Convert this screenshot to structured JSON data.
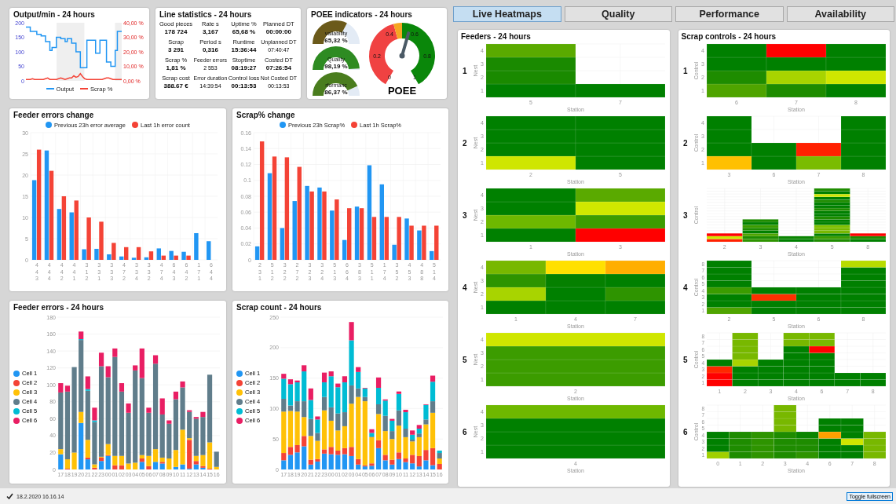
{
  "output_chart": {
    "title": "Output/min - 24 hours",
    "chart_data": {
      "type": "line",
      "ylim": [
        0,
        200
      ],
      "yticks": [
        0,
        50,
        100,
        150,
        200
      ],
      "y2lim": [
        0,
        40
      ],
      "y2ticks": [
        {
          "value": 0,
          "label": "0,00 %"
        },
        {
          "value": 10,
          "label": "10,00 %"
        },
        {
          "value": 20,
          "label": "20,00 %"
        },
        {
          "value": 30,
          "label": "30,00 %"
        },
        {
          "value": 40,
          "label": "40,00 %"
        }
      ],
      "series": [
        {
          "name": "Output",
          "color": "#2196f3",
          "values": [
            185,
            185,
            170,
            170,
            170,
            160,
            160,
            155,
            155,
            135,
            135,
            105,
            115,
            115,
            150,
            150,
            145,
            145,
            135,
            145,
            145,
            130,
            130,
            100,
            100,
            45,
            45,
            45,
            140,
            140,
            140,
            140,
            95,
            95,
            140,
            140,
            140,
            65,
            65,
            50,
            50,
            105,
            170,
            170,
            170
          ]
        },
        {
          "name": "Scrap %",
          "color": "#f44336",
          "axis": "y2",
          "values": [
            1,
            1,
            1,
            1.5,
            1,
            1,
            1,
            1,
            1,
            1.5,
            2,
            1,
            1,
            1,
            1,
            1.5,
            2,
            1.5,
            1,
            1.5,
            2,
            2,
            3.5,
            2.5,
            3,
            5,
            3,
            1.5,
            1,
            1,
            1,
            1,
            1,
            1,
            1,
            1,
            1.5,
            2,
            2,
            1.5,
            1,
            1,
            1,
            1,
            1
          ]
        }
      ]
    }
  },
  "line_statistics": {
    "title": "Line statistics - 24 hours",
    "items": [
      {
        "label": "Good pieces",
        "value": "178 724",
        "kind": "major"
      },
      {
        "label": "Rate s",
        "value": "3,167",
        "kind": "major"
      },
      {
        "label": "Uptime %",
        "value": "65,68 %",
        "kind": "major"
      },
      {
        "label": "Planned DT",
        "value": "00:00:00",
        "kind": "major"
      },
      {
        "label": "Scrap",
        "value": "3 291",
        "kind": "major"
      },
      {
        "label": "Period s",
        "value": "0,316",
        "kind": "major"
      },
      {
        "label": "Runtime",
        "value": "15:36:44",
        "kind": "major"
      },
      {
        "label": "Unplanned DT",
        "value": "07:40:47",
        "kind": "minor"
      },
      {
        "label": "Scrap %",
        "value": "1,81 %",
        "kind": "major"
      },
      {
        "label": "Feeder errors",
        "value": "2 553",
        "kind": "minor"
      },
      {
        "label": "Stoptime",
        "value": "08:19:27",
        "kind": "major"
      },
      {
        "label": "Costed DT",
        "value": "07:26:54",
        "kind": "major"
      },
      {
        "label": "Scrap cost",
        "value": "388.67 €",
        "kind": "major"
      },
      {
        "label": "Error duration",
        "value": "14:39:54",
        "kind": "minor"
      },
      {
        "label": "Control loss",
        "value": "00:13:53",
        "kind": "major"
      },
      {
        "label": "Not Costed DT",
        "value": "00:13:53",
        "kind": "minor"
      }
    ]
  },
  "poee": {
    "title": "POEE indicators - 24 hours",
    "gauges": [
      {
        "label": "vailability",
        "value": "65,32 %",
        "color": "#6b5a1a"
      },
      {
        "label": "Quality",
        "value": "98,19 %",
        "color": "#2e8b22"
      },
      {
        "label": "rformanc",
        "value": "86,37 %",
        "color": "#4a7d1e"
      }
    ],
    "dial": {
      "title": "POEE",
      "ticks": [
        "0",
        "0.2",
        "0.4",
        "0.6",
        "0.8",
        "1"
      ]
    }
  },
  "feeder_errors_change": {
    "title": "Feeder errors change",
    "chart_data": {
      "type": "bar",
      "grid": true,
      "categories": [
        "4\n4\n3",
        "4\n4\n4",
        "4\n4\n2",
        "4\n4\n1",
        "3\n1\n2",
        "3\n3\n1",
        "3\n3\n3",
        "4\n7\n2",
        "3\n3\n4",
        "3\n3\n2",
        "4\n7\n4",
        "6\n4\n3",
        "6\n4\n2",
        "1\n7\n1",
        "6\n4\n4"
      ],
      "ylim": [
        0,
        30
      ],
      "yticks": [
        0,
        5,
        10,
        15,
        20,
        25,
        30
      ],
      "series": [
        {
          "name": "Previous 23h error average",
          "color": "#2196f3",
          "values": [
            18.8,
            25.8,
            12,
            11.2,
            2.5,
            2.6,
            1.3,
            0.8,
            0.5,
            0.6,
            2.7,
            2.1,
            1.9,
            6.3,
            4.4
          ]
        },
        {
          "name": "Last 1h error count",
          "color": "#f44336",
          "values": [
            26,
            21,
            15,
            14,
            10,
            9,
            4,
            3,
            3,
            2,
            1,
            1,
            1,
            0,
            0
          ]
        }
      ]
    }
  },
  "scrap_change": {
    "title": "Scrap% change",
    "chart_data": {
      "type": "bar",
      "grid": true,
      "categories": [
        "2\n3\n1",
        "5\n1\n2",
        "3\n2\n2",
        "2\n7\n2",
        "3\n2\n3",
        "3\n2\n4",
        "5\n1\n3",
        "6\n6\n4",
        "3\n8\n3",
        "5\n1\n1",
        "1\n7\n4",
        "3\n5\n2",
        "4\n5\n3",
        "4\n8\n8",
        "5\n1\n4"
      ],
      "ylim": [
        0,
        0.16
      ],
      "yticks": [
        0,
        0.02,
        0.04,
        0.06,
        0.08,
        0.1,
        0.12,
        0.14,
        0.16
      ],
      "series": [
        {
          "name": "Previous 23h Scrap%",
          "color": "#2196f3",
          "values": [
            0.017,
            0.109,
            0.04,
            0.074,
            0.093,
            0.091,
            0.062,
            0.025,
            0.067,
            0.119,
            0.095,
            0.019,
            0.052,
            0.037,
            0.011
          ]
        },
        {
          "name": "Last 1h Scrap%",
          "color": "#f44336",
          "values": [
            0.149,
            0.13,
            0.129,
            0.117,
            0.086,
            0.086,
            0.076,
            0.065,
            0.065,
            0.054,
            0.054,
            0.054,
            0.043,
            0.043,
            0.043
          ]
        }
      ]
    }
  },
  "feeder_errors": {
    "title": "Feeder errors - 24 hours",
    "chart_data": {
      "type": "bar",
      "stacked": true,
      "grid": true,
      "categories": [
        "17",
        "18",
        "19",
        "20",
        "21",
        "22",
        "23",
        "00",
        "01",
        "02",
        "03",
        "04",
        "05",
        "06",
        "07",
        "08",
        "09",
        "10",
        "11",
        "12",
        "13",
        "14",
        "15",
        "16"
      ],
      "ylim": [
        0,
        180
      ],
      "yticks": [
        0,
        20,
        40,
        60,
        80,
        100,
        120,
        140,
        160,
        180
      ],
      "series": [
        {
          "name": "Cell 1",
          "color": "#2196f3",
          "values": [
            18,
            0,
            0,
            55,
            12,
            0,
            10,
            16,
            0,
            0,
            0,
            0,
            9,
            0,
            9,
            7,
            0,
            3,
            6,
            1,
            6,
            2,
            0,
            0
          ]
        },
        {
          "name": "Cell 2",
          "color": "#f44336",
          "values": [
            0,
            1,
            0,
            0,
            2,
            2,
            4,
            1,
            5,
            5,
            0,
            0,
            4,
            4,
            0,
            2,
            0,
            0,
            0,
            34,
            4,
            2,
            1,
            0
          ]
        },
        {
          "name": "Cell 3",
          "color": "#ffc107",
          "values": [
            6,
            11,
            20,
            13,
            21,
            4,
            1,
            13,
            11,
            11,
            7,
            8,
            4,
            12,
            15,
            5,
            13,
            20,
            41,
            2,
            6,
            13,
            31,
            3
          ]
        },
        {
          "name": "Cell 4",
          "color": "#607d8b",
          "values": [
            67,
            80,
            101,
            85,
            58,
            50,
            107,
            79,
            117,
            76,
            60,
            109,
            91,
            51,
            101,
            51,
            41,
            60,
            50,
            31,
            44,
            45,
            80,
            18
          ]
        },
        {
          "name": "Cell 5",
          "color": "#00bcd4",
          "values": [
            0,
            0,
            0,
            1,
            2,
            2,
            0,
            0,
            0,
            0,
            0,
            0,
            0,
            0,
            0,
            0,
            0,
            0,
            0,
            0,
            0,
            0,
            0,
            0
          ]
        },
        {
          "name": "Cell 6",
          "color": "#e91e63",
          "values": [
            11,
            7,
            0,
            9,
            15,
            15,
            16,
            13,
            10,
            10,
            11,
            6,
            35,
            6,
            10,
            19,
            4,
            9,
            7,
            2,
            2,
            6,
            0,
            0
          ]
        }
      ]
    }
  },
  "scrap_count": {
    "title": "Scrap count - 24 hours",
    "chart_data": {
      "type": "bar",
      "stacked": true,
      "grid": true,
      "categories": [
        "17",
        "18",
        "19",
        "20",
        "21",
        "22",
        "23",
        "00",
        "01",
        "02",
        "03",
        "04",
        "05",
        "06",
        "07",
        "08",
        "09",
        "10",
        "11",
        "12",
        "13",
        "14",
        "15",
        "16"
      ],
      "ylim": [
        0,
        250
      ],
      "yticks": [
        0,
        50,
        100,
        150,
        200,
        250
      ],
      "series": [
        {
          "name": "Cell 1",
          "color": "#2196f3",
          "values": [
            15,
            24,
            28,
            38,
            8,
            13,
            26,
            25,
            24,
            25,
            22,
            8,
            5,
            6,
            35,
            15,
            8,
            17,
            12,
            10,
            5,
            15,
            7,
            0
          ]
        },
        {
          "name": "Cell 2",
          "color": "#f44336",
          "values": [
            12,
            13,
            12,
            17,
            8,
            4,
            7,
            12,
            7,
            10,
            15,
            9,
            2,
            4,
            13,
            9,
            8,
            11,
            6,
            14,
            17,
            17,
            28,
            9
          ]
        },
        {
          "name": "Cell 3",
          "color": "#ffc107",
          "values": [
            68,
            59,
            55,
            31,
            39,
            30,
            64,
            43,
            33,
            36,
            71,
            102,
            105,
            43,
            43,
            39,
            34,
            44,
            35,
            22,
            31,
            42,
            58,
            9
          ]
        },
        {
          "name": "Cell 4",
          "color": "#607d8b",
          "values": [
            21,
            9,
            17,
            26,
            28,
            13,
            22,
            22,
            28,
            23,
            30,
            14,
            7,
            1,
            16,
            25,
            13,
            25,
            14,
            3,
            6,
            8,
            19,
            9
          ]
        },
        {
          "name": "Cell 5",
          "color": "#00bcd4",
          "values": [
            33,
            35,
            31,
            49,
            31,
            22,
            24,
            51,
            43,
            49,
            74,
            27,
            14,
            6,
            27,
            25,
            17,
            27,
            27,
            8,
            8,
            24,
            32,
            4
          ]
        },
        {
          "name": "Cell 6",
          "color": "#e91e63",
          "values": [
            8,
            8,
            3,
            10,
            19,
            5,
            16,
            8,
            6,
            10,
            30,
            8,
            1,
            6,
            17,
            2,
            3,
            4,
            4,
            7,
            6,
            1,
            10,
            0
          ]
        }
      ]
    }
  },
  "tabs": [
    {
      "label": "Live Heatmaps",
      "selected": true
    },
    {
      "label": "Quality",
      "selected": false
    },
    {
      "label": "Performance",
      "selected": false
    },
    {
      "label": "Availability",
      "selected": false
    }
  ],
  "feeders_heatmaps": {
    "title": "Feeders - 24 hours",
    "blocks": [
      {
        "label": "1",
        "y_title": "Nest",
        "x_title": "Station",
        "y_ticks": [
          "4",
          "3",
          "2",
          "1"
        ],
        "columns": [
          {
            "label": "5",
            "cells": [
              {
                "color": "#008000"
              },
              {
                "color": "#1a8a00"
              },
              {
                "color": "#1a8a00"
              },
              {
                "color": "#5aaa00"
              }
            ]
          },
          {
            "label": "7",
            "cells": [
              {
                "color": "#008000"
              }
            ]
          }
        ]
      },
      {
        "label": "2",
        "y_title": "Nest",
        "x_title": "Station",
        "y_ticks": [
          "4",
          "3",
          "2",
          "1"
        ],
        "columns": [
          {
            "label": "2",
            "cells": [
              {
                "color": "#cfe600"
              },
              {
                "color": "#008000"
              },
              {
                "color": "#008000"
              },
              {
                "color": "#008000"
              }
            ]
          },
          {
            "label": "5",
            "cells": [
              {
                "color": "#008000"
              },
              {
                "color": "#008000"
              },
              {
                "color": "#008000"
              },
              {
                "color": "#008000"
              }
            ]
          }
        ]
      },
      {
        "label": "3",
        "y_title": "Nest",
        "x_title": "Station",
        "y_ticks": [
          "4",
          "3",
          "2",
          "1"
        ],
        "columns": [
          {
            "label": "1",
            "cells": [
              {
                "color": "#008000"
              },
              {
                "color": "#6eb800"
              },
              {
                "color": "#008000"
              },
              {
                "color": "#008000"
              }
            ]
          },
          {
            "label": "3",
            "cells": [
              {
                "color": "#ff0000"
              },
              {
                "color": "#3c9c00"
              },
              {
                "color": "#d0e800"
              },
              {
                "color": "#5aaa00"
              }
            ]
          }
        ]
      },
      {
        "label": "4",
        "y_title": "Nest",
        "x_title": "Station",
        "y_ticks": [
          "4",
          "3",
          "2",
          "1"
        ],
        "columns": [
          {
            "label": "1",
            "cells": [
              {
                "color": "#008000"
              },
              {
                "color": "#a8d400"
              },
              {
                "color": "#2e9400"
              },
              {
                "color": "#78b800"
              }
            ]
          },
          {
            "label": "4",
            "cells": [
              {
                "color": "#008000"
              },
              {
                "color": "#008000"
              },
              {
                "color": "#058000"
              },
              {
                "color": "#ffe000"
              }
            ]
          },
          {
            "label": "7",
            "cells": [
              {
                "color": "#008000"
              },
              {
                "color": "#2e9400"
              },
              {
                "color": "#008000"
              },
              {
                "color": "#ffae00"
              }
            ]
          }
        ]
      },
      {
        "label": "5",
        "y_title": "Nest",
        "x_title": "Station",
        "y_ticks": [
          "4",
          "3",
          "2",
          "1"
        ],
        "columns": [
          {
            "label": "2",
            "cells": [
              {
                "color": "#3c9c00"
              },
              {
                "color": "#3c9c00"
              },
              {
                "color": "#3c9c00"
              },
              {
                "color": "#cfe600"
              }
            ]
          }
        ]
      },
      {
        "label": "6",
        "y_title": "Nest",
        "x_title": "Station",
        "y_ticks": [
          "4",
          "3",
          "2",
          "1"
        ],
        "columns": [
          {
            "label": "4",
            "cells": [
              {
                "color": "#008000"
              },
              {
                "color": "#008000"
              },
              {
                "color": "#008000"
              },
              {
                "color": "#6eb800"
              }
            ]
          }
        ]
      }
    ]
  },
  "scrap_controls_heatmaps": {
    "title": "Scrap controls - 24 hours",
    "blocks": [
      {
        "label": "1",
        "y_title": "Control",
        "x_title": "Station",
        "y_ticks": [
          "4",
          "3",
          "2",
          "1"
        ],
        "columns": [
          {
            "label": "6",
            "cells": [
              {
                "color": "#4fa400"
              },
              {
                "color": "#1e8c00"
              },
              {
                "color": "#008000"
              },
              {
                "color": "#008000"
              }
            ]
          },
          {
            "label": "7",
            "cells": [
              {
                "color": "#1e8c00"
              },
              {
                "color": "#a8d400"
              },
              {
                "color": "#008000"
              },
              {
                "color": "#ff0000"
              }
            ]
          },
          {
            "label": "8",
            "cells": [
              {
                "color": "#008000"
              },
              {
                "color": "#cfe600"
              },
              {
                "color": "#008000"
              },
              {
                "color": "#008000"
              }
            ]
          }
        ]
      },
      {
        "label": "2",
        "y_title": "Control",
        "x_title": "Station",
        "y_ticks": [
          "4",
          "3",
          "2",
          "1"
        ],
        "columns": [
          {
            "label": "3",
            "cells": [
              {
                "color": "#ffc000"
              },
              {
                "color": "#008000"
              },
              {
                "color": "#008000"
              },
              {
                "color": "#008000"
              }
            ]
          },
          {
            "label": "6",
            "cells": [
              {
                "color": "#008000"
              },
              {
                "color": "#008000"
              }
            ]
          },
          {
            "label": "7",
            "cells": [
              {
                "color": "#7abc00"
              },
              {
                "color": "#ff2000"
              }
            ]
          },
          {
            "label": "8",
            "cells": [
              {
                "color": "#008000"
              },
              {
                "color": "#008000"
              },
              {
                "color": "#008000"
              },
              {
                "color": "#008000"
              }
            ]
          }
        ]
      },
      {
        "label": "3",
        "y_title": "Control",
        "x_title": "Station",
        "columns": [
          {
            "label": "2",
            "cells": [
              {
                "color": "#ff2000"
              },
              {
                "color": "#cfe600"
              },
              {
                "color": "#ff0000"
              }
            ]
          },
          {
            "label": "3",
            "cells": [
              {
                "color": "#2e9400"
              },
              {
                "color": "#1e8c00"
              },
              {
                "color": "#4fa400"
              },
              {
                "color": "#008000"
              },
              {
                "color": "#1e8c00"
              },
              {
                "color": "#3c9c00"
              },
              {
                "color": "#008000"
              },
              {
                "color": "#1e8c00"
              }
            ]
          },
          {
            "label": "4",
            "cells": [
              {
                "color": "#008000"
              },
              {
                "color": "#0a8400"
              }
            ]
          },
          {
            "label": "5",
            "cells": [
              {
                "color": "#1e8c00"
              },
              {
                "color": "#3c9c00"
              },
              {
                "color": "#008000"
              },
              {
                "color": "#78b800"
              },
              {
                "color": "#78b800"
              },
              {
                "color": "#80c000"
              },
              {
                "color": "#008000"
              },
              {
                "color": "#008000"
              },
              {
                "color": "#1e8c00"
              },
              {
                "color": "#008000"
              },
              {
                "color": "#008000"
              },
              {
                "color": "#1e8c00"
              },
              {
                "color": "#008000"
              },
              {
                "color": "#008000"
              },
              {
                "color": "#1e8c00"
              },
              {
                "color": "#008000"
              },
              {
                "color": "#cfe600"
              },
              {
                "color": "#008000"
              },
              {
                "color": "#1e8c00"
              }
            ]
          },
          {
            "label": "8",
            "cells": [
              {
                "color": "#008000"
              },
              {
                "color": "#1e8c00"
              },
              {
                "color": "#ff0000"
              }
            ]
          }
        ]
      },
      {
        "label": "4",
        "y_title": "Control",
        "x_title": "Station",
        "y_ticks": [
          "8",
          "7",
          "6",
          "5",
          "4",
          "3",
          "2",
          "1"
        ],
        "columns": [
          {
            "label": "2",
            "cells": [
              {
                "color": "#4fa400"
              },
              {
                "color": "#008000"
              },
              {
                "color": "#008000"
              },
              {
                "color": "#3c9c00"
              },
              {
                "color": "#008000"
              },
              {
                "color": "#008000"
              },
              {
                "color": "#008000"
              },
              {
                "color": "#008000"
              }
            ]
          },
          {
            "label": "5",
            "cells": [
              {
                "color": "#008000"
              },
              {
                "color": "#008000"
              },
              {
                "color": "#ff3000"
              },
              {
                "color": "#008000"
              }
            ]
          },
          {
            "label": "6",
            "cells": [
              {
                "color": "#008000"
              },
              {
                "color": "#008000"
              },
              {
                "color": "#008000"
              },
              {
                "color": "#008000"
              }
            ]
          },
          {
            "label": "8",
            "cells": [
              {
                "color": "#008000"
              },
              {
                "color": "#008000"
              },
              {
                "color": "#008000"
              },
              {
                "color": "#008000"
              },
              {
                "color": "#008000"
              },
              {
                "color": "#008000"
              },
              {
                "color": "#008000"
              },
              {
                "color": "#b8dc00"
              }
            ]
          }
        ]
      },
      {
        "label": "5",
        "y_title": "Control",
        "x_title": "Station",
        "y_ticks": [
          "8",
          "7",
          "6",
          "5",
          "4",
          "3",
          "2",
          "1"
        ],
        "columns": [
          {
            "label": "1",
            "cells": [
              {
                "color": "#ff0000"
              },
              {
                "color": "#ff0000"
              },
              {
                "color": "#ff2800"
              },
              {
                "color": "#008000"
              }
            ]
          },
          {
            "label": "2",
            "cells": [
              {
                "color": "#008000"
              },
              {
                "color": "#008000"
              },
              {
                "color": "#008000"
              },
              {
                "color": "#a8d400"
              },
              {
                "color": "#78b800"
              },
              {
                "color": "#78b800"
              },
              {
                "color": "#78b800"
              },
              {
                "color": "#78b800"
              }
            ]
          },
          {
            "label": "3",
            "cells": [
              {
                "color": "#008000"
              },
              {
                "color": "#008000"
              },
              {
                "color": "#008000"
              },
              {
                "color": "#008000"
              }
            ]
          },
          {
            "label": "4",
            "cells": [
              {
                "color": "#008000"
              },
              {
                "color": "#008000"
              },
              {
                "color": "#008000"
              },
              {
                "color": "#008000"
              },
              {
                "color": "#008000"
              },
              {
                "color": "#008000"
              },
              {
                "color": "#78b800"
              },
              {
                "color": "#78b800"
              }
            ]
          },
          {
            "label": "6",
            "cells": [
              {
                "color": "#008000"
              },
              {
                "color": "#008000"
              },
              {
                "color": "#008000"
              },
              {
                "color": "#008000"
              },
              {
                "color": "#008000"
              },
              {
                "color": "#ff0000"
              },
              {
                "color": "#78b800"
              },
              {
                "color": "#78b800"
              }
            ]
          },
          {
            "label": "7",
            "cells": [
              {
                "color": "#008000"
              },
              {
                "color": "#008000"
              }
            ]
          },
          {
            "label": "8",
            "cells": [
              {
                "color": "#008000"
              },
              {
                "color": "#008000"
              }
            ]
          }
        ]
      },
      {
        "label": "6",
        "y_title": "Control",
        "x_title": "Station",
        "y_ticks": [
          "8",
          "7",
          "6",
          "5",
          "4",
          "3",
          "2",
          "1"
        ],
        "columns": [
          {
            "label": "0",
            "cells": [
              {
                "color": "#a0d000"
              },
              {
                "color": "#008000"
              },
              {
                "color": "#008000"
              },
              {
                "color": "#008000"
              }
            ]
          },
          {
            "label": "1",
            "cells": [
              {
                "color": "#1e8c00"
              },
              {
                "color": "#1e8c00"
              },
              {
                "color": "#1e8c00"
              },
              {
                "color": "#1e8c00"
              }
            ]
          },
          {
            "label": "2",
            "cells": [
              {
                "color": "#2e9400"
              },
              {
                "color": "#2e9400"
              },
              {
                "color": "#2e9400"
              },
              {
                "color": "#2e9400"
              }
            ]
          },
          {
            "label": "3",
            "cells": [
              {
                "color": "#1e8c00"
              },
              {
                "color": "#1e8c00"
              },
              {
                "color": "#1e8c00"
              },
              {
                "color": "#1e8c00"
              },
              {
                "color": "#78b800"
              },
              {
                "color": "#78b800"
              },
              {
                "color": "#78b800"
              },
              {
                "color": "#78b800"
              }
            ]
          },
          {
            "label": "4",
            "cells": [
              {
                "color": "#2e9400"
              },
              {
                "color": "#1e8c00"
              },
              {
                "color": "#1e8c00"
              },
              {
                "color": "#0a8400"
              }
            ]
          },
          {
            "label": "6",
            "cells": [
              {
                "color": "#008000"
              },
              {
                "color": "#008000"
              },
              {
                "color": "#008000"
              },
              {
                "color": "#ffa000"
              },
              {
                "color": "#008000"
              },
              {
                "color": "#008000"
              }
            ]
          },
          {
            "label": "7",
            "cells": [
              {
                "color": "#008000"
              },
              {
                "color": "#008000"
              },
              {
                "color": "#cfe600"
              },
              {
                "color": "#008000"
              },
              {
                "color": "#008000"
              },
              {
                "color": "#008000"
              }
            ]
          },
          {
            "label": "8",
            "cells": [
              {
                "color": "#78b800"
              },
              {
                "color": "#78b800"
              },
              {
                "color": "#78b800"
              },
              {
                "color": "#78b800"
              }
            ]
          }
        ]
      }
    ]
  },
  "status_bar": {
    "status": "18.2.2020 16.16.14",
    "button": "Toggle fullscreen"
  }
}
